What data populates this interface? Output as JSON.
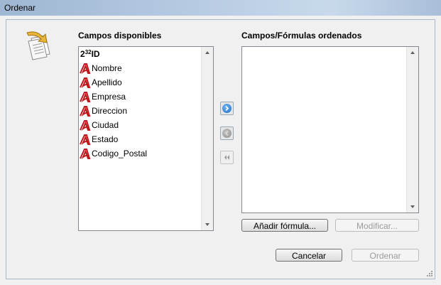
{
  "window": {
    "title": "Ordenar"
  },
  "available": {
    "label": "Campos disponibles",
    "items": [
      {
        "kind": "number",
        "base": "2",
        "exp": "32",
        "label": "ID"
      },
      {
        "kind": "text",
        "label": "Nombre"
      },
      {
        "kind": "text",
        "label": "Apellido"
      },
      {
        "kind": "text",
        "label": "Empresa"
      },
      {
        "kind": "text",
        "label": "Direccion"
      },
      {
        "kind": "text",
        "label": "Ciudad"
      },
      {
        "kind": "text",
        "label": "Estado"
      },
      {
        "kind": "text",
        "label": "Codigo_Postal"
      }
    ]
  },
  "sorted": {
    "label": "Campos/Fórmulas ordenados",
    "items": []
  },
  "buttons": {
    "add_formula": "Añadir fórmula...",
    "modify": "Modificar...",
    "cancel": "Cancelar",
    "sort": "Ordenar"
  },
  "colors": {
    "accent_blue": "#2a7fd4",
    "field_icon_red": "#c0161c"
  }
}
